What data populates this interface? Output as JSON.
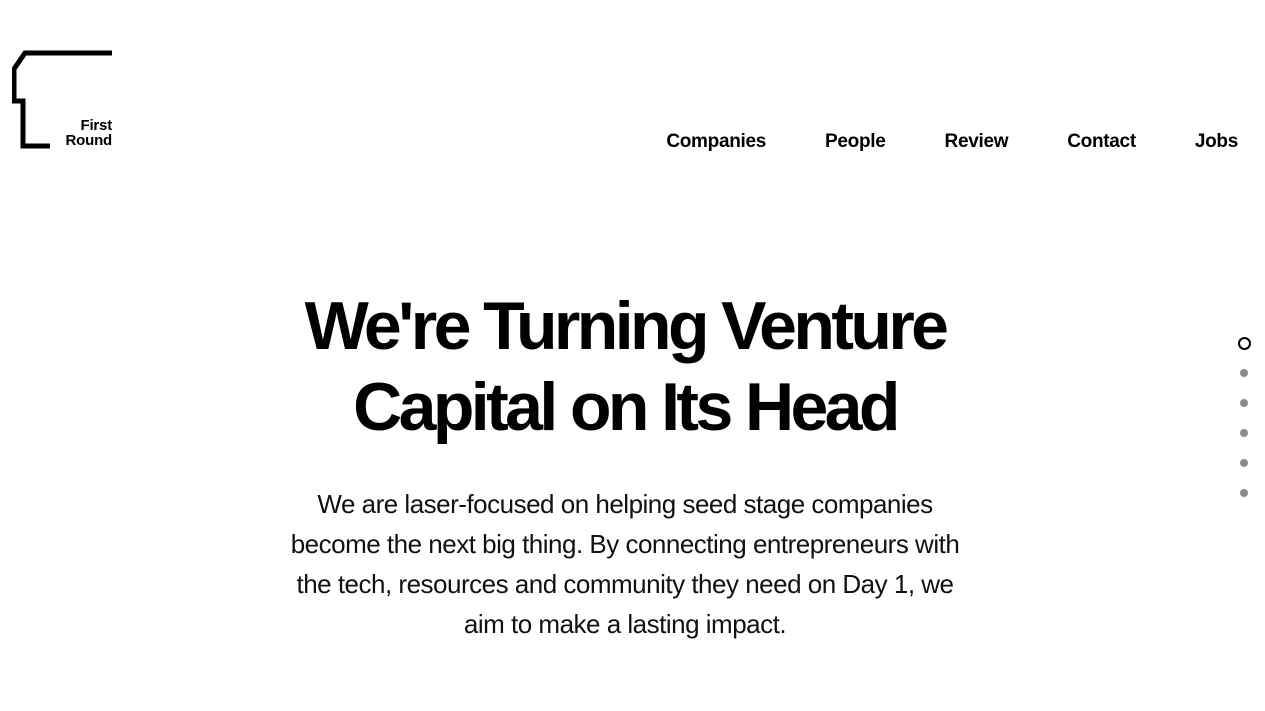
{
  "brand": {
    "line1": "First",
    "line2": "Round"
  },
  "nav": {
    "items": [
      "Companies",
      "People",
      "Review",
      "Contact",
      "Jobs"
    ]
  },
  "hero": {
    "title_line1": "We're Turning Venture",
    "title_line2": "Capital on Its Head",
    "body": "We are laser-focused on helping seed stage companies become the next big thing. By connecting entrepreneurs with the tech, resources and community they need on Day 1, we aim to make a lasting impact."
  },
  "section_dots": {
    "count": 6,
    "active_index": 0
  },
  "colors": {
    "text": "#000000",
    "background": "#ffffff",
    "inactive_dot": "#8c8c8c"
  }
}
